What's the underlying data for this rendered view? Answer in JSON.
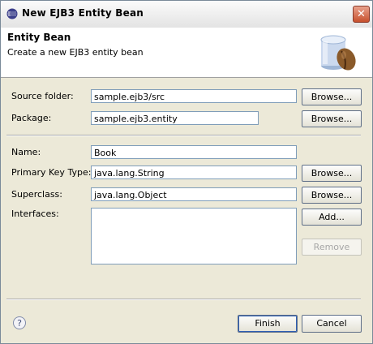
{
  "window": {
    "title": "New EJB3 Entity Bean",
    "close_label": "✕"
  },
  "banner": {
    "title": "Entity Bean",
    "description": "Create a new EJB3 entity bean",
    "icon": "entity-bean-icon"
  },
  "form": {
    "source_folder": {
      "label": "Source folder:",
      "value": "sample.ejb3/src",
      "button": "Browse..."
    },
    "package": {
      "label": "Package:",
      "value": "sample.ejb3.entity",
      "button": "Browse..."
    },
    "name": {
      "label": "Name:",
      "value": "Book"
    },
    "primary_key_type": {
      "label": "Primary Key Type:",
      "value": "java.lang.String",
      "button": "Browse..."
    },
    "superclass": {
      "label": "Superclass:",
      "value": "java.lang.Object",
      "button": "Browse..."
    },
    "interfaces": {
      "label": "Interfaces:",
      "items": [],
      "add_button": "Add...",
      "remove_button": "Remove"
    }
  },
  "footer": {
    "help": "?",
    "finish": "Finish",
    "cancel": "Cancel"
  }
}
